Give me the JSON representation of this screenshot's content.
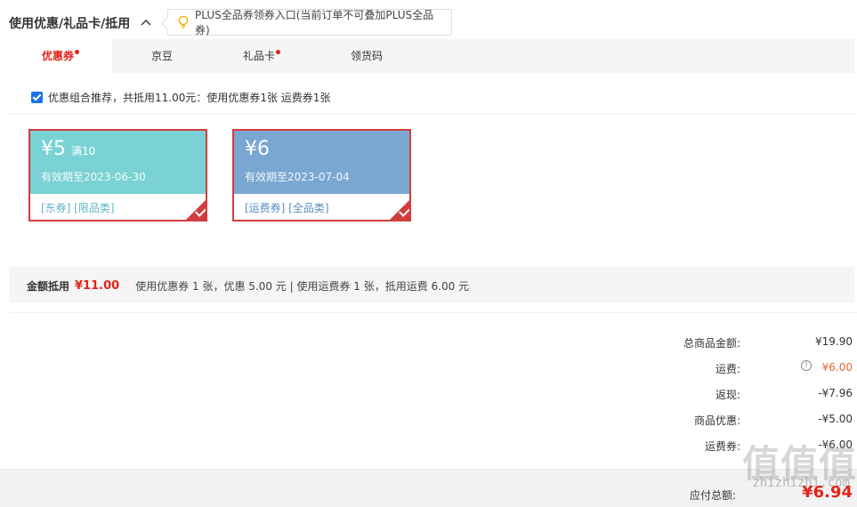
{
  "header": {
    "title": "使用优惠/礼品卡/抵用",
    "plus_tip": "PLUS全品券领券入口(当前订单不可叠加PLUS全品券)"
  },
  "tabs": [
    {
      "label": "优惠券",
      "dot": true,
      "active": true
    },
    {
      "label": "京豆",
      "dot": false,
      "active": false
    },
    {
      "label": "礼品卡",
      "dot": true,
      "active": false
    },
    {
      "label": "领货码",
      "dot": false,
      "active": false
    }
  ],
  "combo": {
    "checked": true,
    "text": "优惠组合推荐，共抵用11.00元：使用优惠券1张 运费券1张"
  },
  "coupons": [
    {
      "amount": "¥5",
      "condition": "满10",
      "valid": "有效期至2023-06-30",
      "tags": "[东券]  [限品类]",
      "selected": true
    },
    {
      "amount": "¥6",
      "condition": "",
      "valid": "有效期至2023-07-04",
      "tags": "[运费券]  [全品类]",
      "selected": true
    }
  ],
  "summary": {
    "label": "金额抵用",
    "amount": "¥11.00",
    "detail": "使用优惠券 1 张，优惠 5.00 元  | 使用运费券 1 张，抵用运费 6.00 元"
  },
  "totals": [
    {
      "label": "总商品金额:",
      "value": "¥19.90"
    },
    {
      "label": "运费:",
      "value": "¥6.00"
    },
    {
      "label": "返现:",
      "value": "-¥7.96"
    },
    {
      "label": "商品优惠:",
      "value": "-¥5.00"
    },
    {
      "label": "运费券:",
      "value": "-¥6.00"
    }
  ],
  "payable": {
    "label": "应付总额:",
    "value": "¥6.94"
  },
  "watermark": {
    "main": "值值值",
    "sub": "zhizhizhi.com"
  },
  "colors": {
    "accent_red": "#e2231a",
    "coupon_teal": "#7ad2d4",
    "coupon_blue": "#7aa7d1",
    "freight_orange": "#e2662a"
  }
}
